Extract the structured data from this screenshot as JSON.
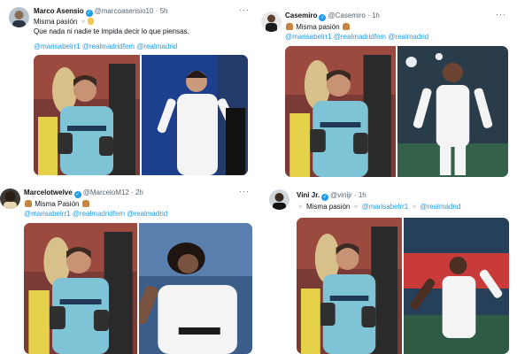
{
  "tweets": [
    {
      "name": "Marco Asensio",
      "handle": "@marcoasensio10",
      "time": "5h",
      "text": "Misma pasión",
      "text2": "Que nada ni nadie te impida decir lo que piensas.",
      "mentions": [
        "@marisabelrr1",
        "@realmadridfem",
        "@realmadrid"
      ]
    },
    {
      "name": "Casemiro",
      "handle": "@Casemiro",
      "time": "1h",
      "text": "Misma pasión",
      "mentions": [
        "@marisabelrr1",
        "@realmadridfem",
        "@realmadrid"
      ]
    },
    {
      "name": "Marcelotwelve",
      "handle": "@MarceloM12",
      "time": "2h",
      "text": "Misma Pasión",
      "mentions": [
        "@marisabelrr1",
        "@realmadridfem",
        "@realmadrid"
      ]
    },
    {
      "name": "Vini Jr.",
      "handle": "@vinijr",
      "time": "1h",
      "text": "Misma pasión",
      "mentions": [
        "@marisabelrr1",
        "@realmadrid"
      ]
    }
  ],
  "common": {
    "sep": "·",
    "more": "···",
    "jersey_sponsor": "Emirates"
  },
  "colors": {
    "link": "#1d9bf0",
    "verified": "#1d9bf0",
    "celta_kit": "#7fc3d6",
    "rm_kit": "#f4f4f4"
  },
  "icons": [
    "verified-badge-icon",
    "more-icon",
    "muscle-emoji",
    "heart-emoji",
    "hand-emoji"
  ]
}
